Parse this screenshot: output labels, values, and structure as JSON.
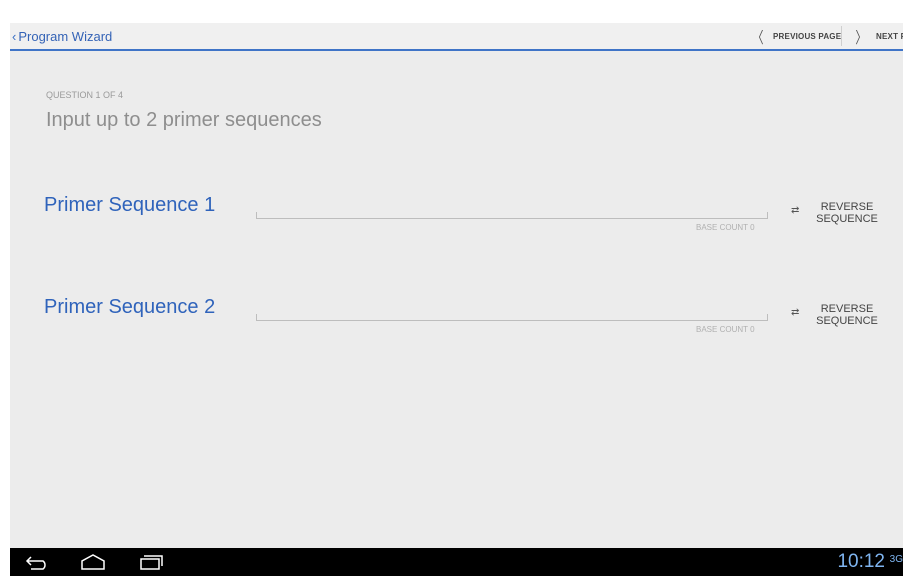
{
  "actionbar": {
    "back_title": "Program Wizard",
    "prev_label": "PREVIOUS PAGE",
    "next_label": "NEXT PAGE"
  },
  "question": {
    "counter": "QUESTION 1 OF 4",
    "title": "Input up to 2 primer sequences"
  },
  "primers": [
    {
      "label": "Primer Sequence 1",
      "value": "",
      "base_count": "BASE COUNT 0",
      "reverse_label": "REVERSE SEQUENCE"
    },
    {
      "label": "Primer Sequence 2",
      "value": "",
      "base_count": "BASE COUNT 0",
      "reverse_label": "REVERSE SEQUENCE"
    }
  ],
  "system_bar": {
    "time": "10:12",
    "network": "3G"
  },
  "colors": {
    "accent": "#3f74c7",
    "label_blue": "#2f63bb",
    "clock": "#7fb5f0"
  }
}
